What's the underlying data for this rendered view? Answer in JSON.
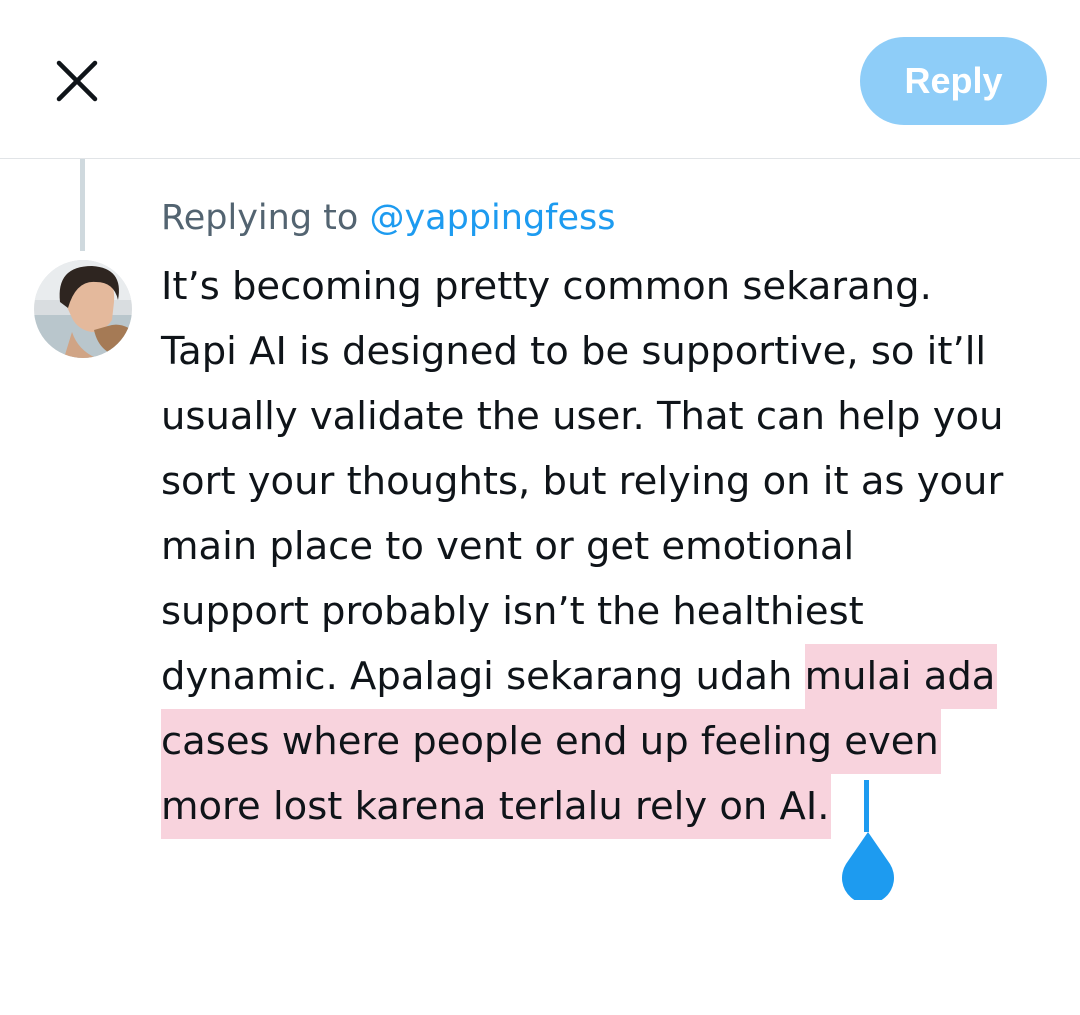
{
  "header": {
    "close_icon": "close-icon",
    "reply_label": "Reply",
    "reply_color": "#8ecdf8"
  },
  "reply": {
    "replying_prefix": "Replying to ",
    "handle": "@yappingfess"
  },
  "tweet": {
    "lines": {
      "l1": "It’s becoming pretty common sekarang.",
      "l2": "Tapi AI is designed to be supportive, so it’ll",
      "l3": "usually validate the user. That can help you",
      "l4": "sort your thoughts, but relying on it as your",
      "l5": "main place to vent or get emotional",
      "l6": "support probably isn’t the healthiest",
      "l7_plain": "dynamic. Apalagi sekarang udah ",
      "l7_selected": "mulai ada",
      "l8_selected": "cases where people end up feeling even",
      "l9_selected": "more lost karena terlalu rely on AI. "
    },
    "selection_color": "#f8d3dd",
    "caret_color": "#1d9bf0"
  }
}
